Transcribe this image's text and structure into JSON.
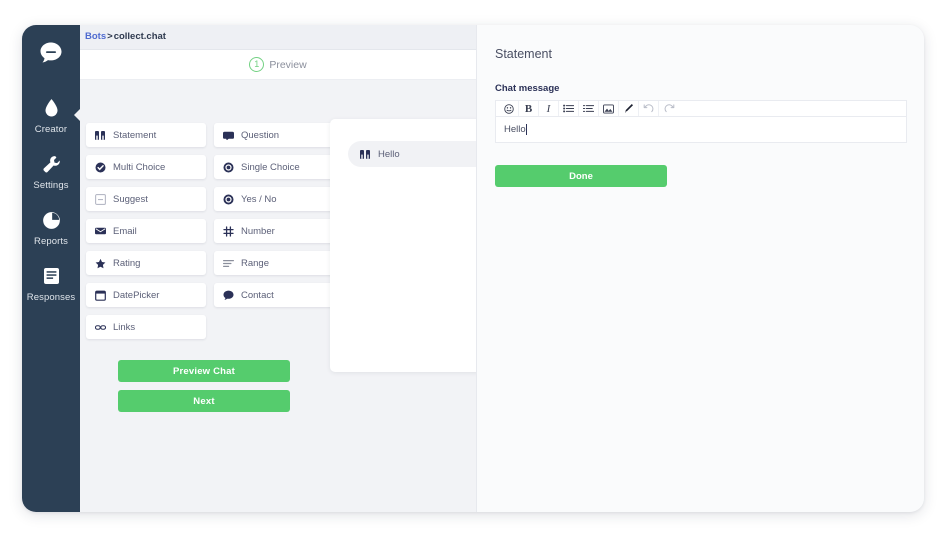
{
  "sidebar": {
    "logo_icon": "chat-bubble-icon",
    "items": [
      {
        "label": "Creator",
        "icon": "water-drop-icon",
        "active": true
      },
      {
        "label": "Settings",
        "icon": "wrench-icon",
        "active": false
      },
      {
        "label": "Reports",
        "icon": "pie-chart-icon",
        "active": false
      },
      {
        "label": "Responses",
        "icon": "document-lines-icon",
        "active": false
      }
    ]
  },
  "breadcrumb": {
    "root": "Bots",
    "separator": ">",
    "current": "collect.chat"
  },
  "step": {
    "number": "1",
    "label": "Preview"
  },
  "palette": {
    "widgets": [
      {
        "label": "Statement",
        "icon": "quote-icon"
      },
      {
        "label": "Question",
        "icon": "speech-bubble-icon"
      },
      {
        "label": "Multi Choice",
        "icon": "check-circle-icon"
      },
      {
        "label": "Single Choice",
        "icon": "radio-circle-icon"
      },
      {
        "label": "Suggest",
        "icon": "suggest-box-icon"
      },
      {
        "label": "Yes / No",
        "icon": "radio-circle-icon"
      },
      {
        "label": "Email",
        "icon": "envelope-icon"
      },
      {
        "label": "Number",
        "icon": "hash-icon"
      },
      {
        "label": "Rating",
        "icon": "star-icon"
      },
      {
        "label": "Range",
        "icon": "range-lines-icon"
      },
      {
        "label": "DatePicker",
        "icon": "calendar-icon"
      },
      {
        "label": "Contact",
        "icon": "contact-icon"
      },
      {
        "label": "Links",
        "icon": "link-icon"
      }
    ],
    "preview_chat_label": "Preview Chat",
    "next_label": "Next"
  },
  "canvas": {
    "nodes": [
      {
        "label": "Hello",
        "icon": "quote-icon"
      }
    ]
  },
  "panel": {
    "title": "Statement",
    "field_label": "Chat message",
    "toolbar": [
      {
        "name": "emoji-icon",
        "glyph": "☺",
        "muted": false
      },
      {
        "name": "bold-icon",
        "glyph": "B",
        "muted": false
      },
      {
        "name": "italic-icon",
        "glyph": "I",
        "muted": false
      },
      {
        "name": "bullet-list-icon",
        "glyph": "☰",
        "muted": false
      },
      {
        "name": "ordered-list-icon",
        "glyph": "☰",
        "muted": false
      },
      {
        "name": "image-icon",
        "glyph": "⛰",
        "muted": false
      },
      {
        "name": "pen-icon",
        "glyph": "✒",
        "muted": false
      },
      {
        "name": "undo-icon",
        "glyph": "↺",
        "muted": true
      },
      {
        "name": "redo-icon",
        "glyph": "↻",
        "muted": true
      }
    ],
    "message_value": "Hello",
    "message_placeholder": "",
    "done_label": "Done"
  },
  "colors": {
    "rail": "#2c4055",
    "accent_green": "#55cc6d",
    "link_blue": "#4f6bd0",
    "page_bg": "#f2f3f6"
  }
}
